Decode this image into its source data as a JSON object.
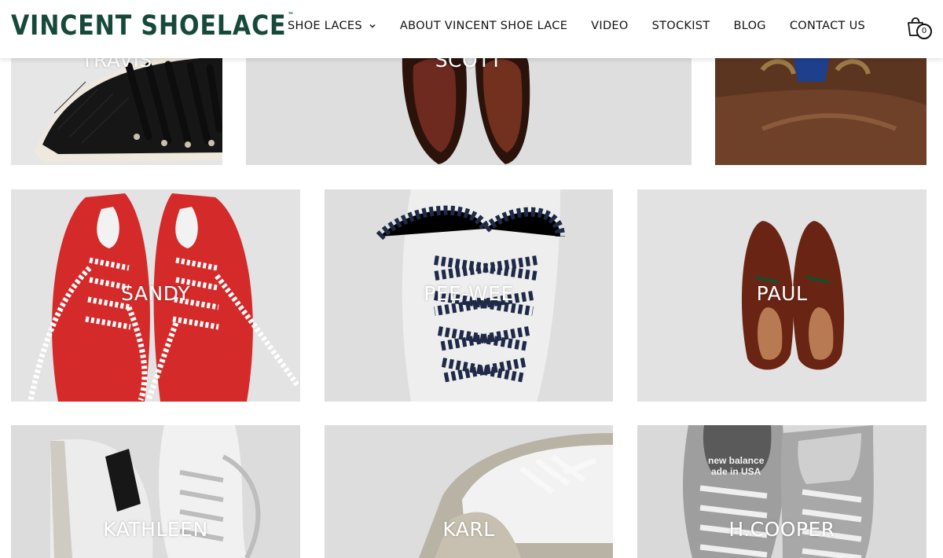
{
  "brand": {
    "logo_text": "VINCENT SHOELACE",
    "trademark": "™",
    "logo_color": "#17493a"
  },
  "nav": {
    "items": [
      {
        "label": "SHOE LACES",
        "has_dropdown": true
      },
      {
        "label": "ABOUT VINCENT SHOE LACE"
      },
      {
        "label": "VIDEO"
      },
      {
        "label": "STOCKIST"
      },
      {
        "label": "BLOG"
      },
      {
        "label": "CONTACT US"
      }
    ],
    "cart_icon": "shopping-bag-icon",
    "cart_count": "0"
  },
  "products": [
    {
      "name": "TRAVIS",
      "tile_bg": "#e6e6e6",
      "shoe": "black-leather-sneaker"
    },
    {
      "name": "SCOTT",
      "tile_bg": "#dedede",
      "shoe": "brown-loafers"
    },
    {
      "name": "",
      "tile_bg": "#5a3520",
      "shoe": "brown-boot-closeup"
    },
    {
      "name": "SANDY",
      "tile_bg": "#e3e3e3",
      "shoe": "red-suede-sneakers"
    },
    {
      "name": "PEE-WEE",
      "tile_bg": "#dedede",
      "shoe": "white-sneaker-striped-laces"
    },
    {
      "name": "PAUL",
      "tile_bg": "#e2e2e2",
      "shoe": "brown-derby-shoes"
    },
    {
      "name": "KATHLEEN",
      "tile_bg": "#dcdcdc",
      "shoe": "white-high-tops"
    },
    {
      "name": "KARL",
      "tile_bg": "#dddddd",
      "shoe": "white-trainers"
    },
    {
      "name": "H.COOPER",
      "tile_bg": "#d9d9d9",
      "shoe": "grey-new-balance",
      "shoe_text_1": "new balance",
      "shoe_text_2": "ade in USA"
    }
  ]
}
